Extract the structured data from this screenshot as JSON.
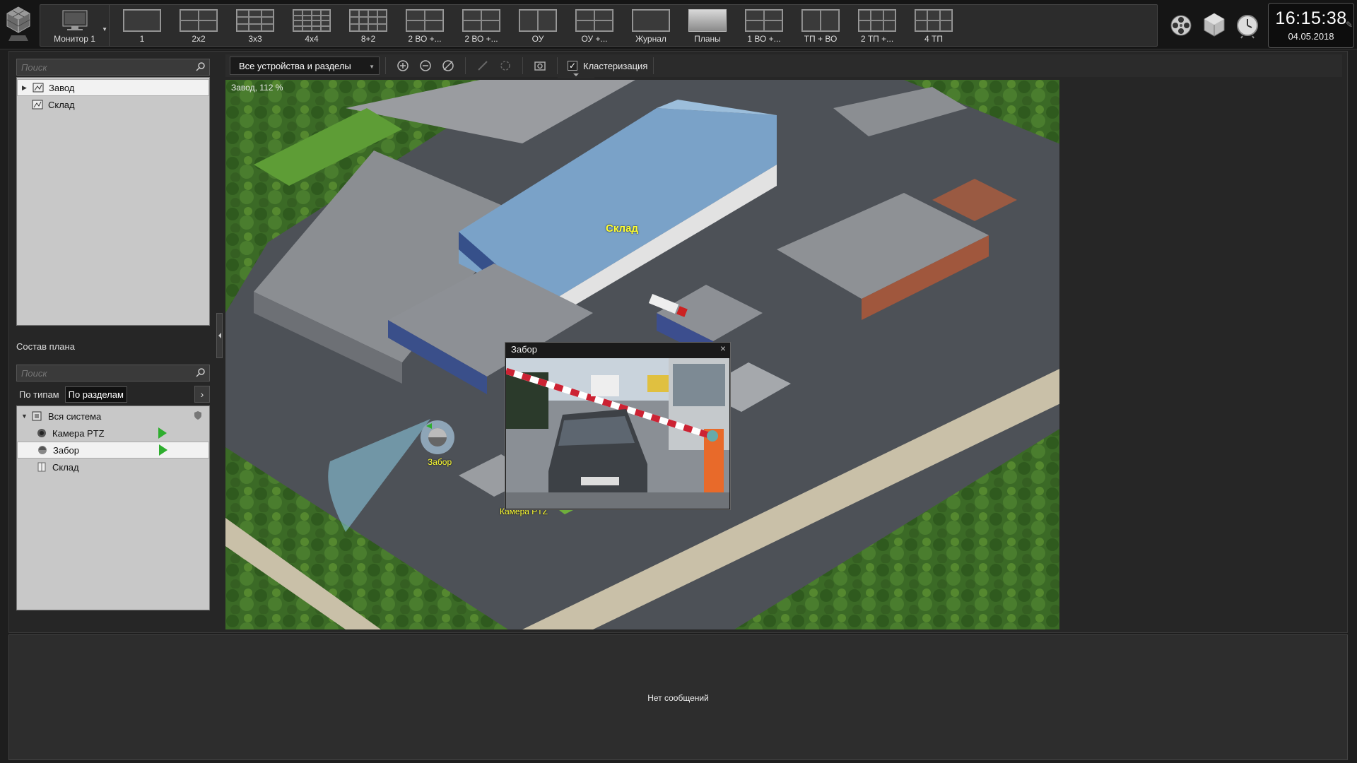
{
  "toolbar": {
    "monitor_label": "Монитор 1",
    "layouts": [
      {
        "label": "1",
        "grid": [
          1,
          1
        ]
      },
      {
        "label": "2x2",
        "grid": [
          2,
          2
        ]
      },
      {
        "label": "3x3",
        "grid": [
          3,
          3
        ]
      },
      {
        "label": "4x4",
        "grid": [
          4,
          4
        ]
      },
      {
        "label": "8+2",
        "grid": [
          4,
          3
        ]
      },
      {
        "label": "2 ВО +...",
        "grid": [
          2,
          2
        ]
      },
      {
        "label": "2 ВО +...",
        "grid": [
          2,
          2
        ]
      },
      {
        "label": "ОУ",
        "grid": [
          2,
          1
        ]
      },
      {
        "label": "ОУ +...",
        "grid": [
          2,
          2
        ]
      },
      {
        "label": "Журнал",
        "grid": [
          1,
          1
        ]
      },
      {
        "label": "Планы",
        "grid": [
          1,
          1
        ]
      },
      {
        "label": "1 ВО +...",
        "grid": [
          2,
          2
        ]
      },
      {
        "label": "ТП + ВО",
        "grid": [
          2,
          1
        ]
      },
      {
        "label": "2 ТП +...",
        "grid": [
          3,
          2
        ]
      },
      {
        "label": "4 ТП",
        "grid": [
          3,
          2
        ]
      }
    ]
  },
  "clock": {
    "time": "16:15:38",
    "date": "04.05.2018"
  },
  "plans": {
    "search_placeholder": "Поиск",
    "items": [
      {
        "label": "Завод",
        "selected": true
      },
      {
        "label": "Склад",
        "selected": false
      }
    ]
  },
  "composition": {
    "title": "Состав плана",
    "search_placeholder": "Поиск",
    "tabs": [
      {
        "label": "По типам",
        "active": false
      },
      {
        "label": "По разделам",
        "active": true
      }
    ],
    "tab_arrow": "›",
    "items": [
      {
        "label": "Вся система",
        "icon": "system-icon",
        "indent": 0
      },
      {
        "label": "Камера PTZ",
        "icon": "camera-icon",
        "indent": 1,
        "play": true
      },
      {
        "label": "Забор",
        "icon": "dome-camera-icon",
        "indent": 1,
        "play": true,
        "selected": true
      },
      {
        "label": "Склад",
        "icon": "plan-icon",
        "indent": 1
      }
    ]
  },
  "plan_toolbar": {
    "device_filter": "Все устройства и разделы",
    "clustering_label": "Кластеризация",
    "clustering_checked": true
  },
  "map": {
    "caption": "Завод, 112 %",
    "building_label": "Склад",
    "camera_labels": {
      "fence": "Забор",
      "ptz": "Камера PTZ"
    }
  },
  "popup": {
    "title": "Забор",
    "close": "×"
  },
  "messages": {
    "empty_text": "Нет сообщений"
  },
  "colors": {
    "accent_green": "#2eae2e",
    "label_yellow": "#ffff33",
    "background": "#1e1e1e"
  }
}
